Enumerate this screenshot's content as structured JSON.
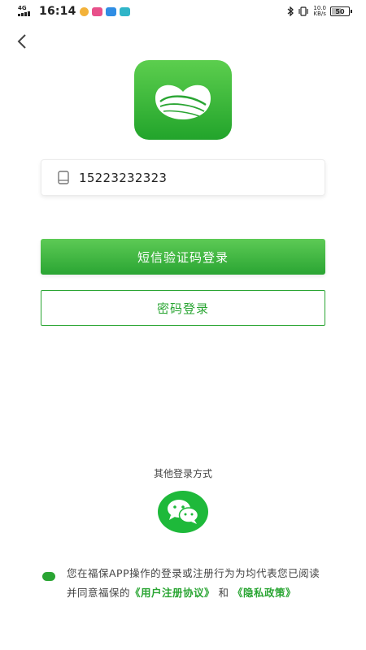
{
  "status_bar": {
    "network": "4G",
    "time": "16:14",
    "net_speed_value": "10.0",
    "net_speed_unit": "KB/s",
    "battery": "50"
  },
  "icons": {
    "back": "chevron-left-icon",
    "phone": "phone-icon",
    "wechat": "wechat-icon",
    "logo": "fubao-app-logo"
  },
  "colors": {
    "primary": "#2aa533",
    "primary_light": "#5dca55",
    "wechat": "#1eb93a"
  },
  "login": {
    "phone_value": "15223232323",
    "sms_button": "短信验证码登录",
    "password_button": "密码登录"
  },
  "other_login": {
    "label": "其他登录方式"
  },
  "agreement": {
    "checked": true,
    "text_prefix": "您在福保APP操作的登录或注册行为为均代表您已阅读并同意福保的",
    "user_agreement_link": "《用户注册协议》",
    "and": "和",
    "privacy_link": "《隐私政策》"
  }
}
